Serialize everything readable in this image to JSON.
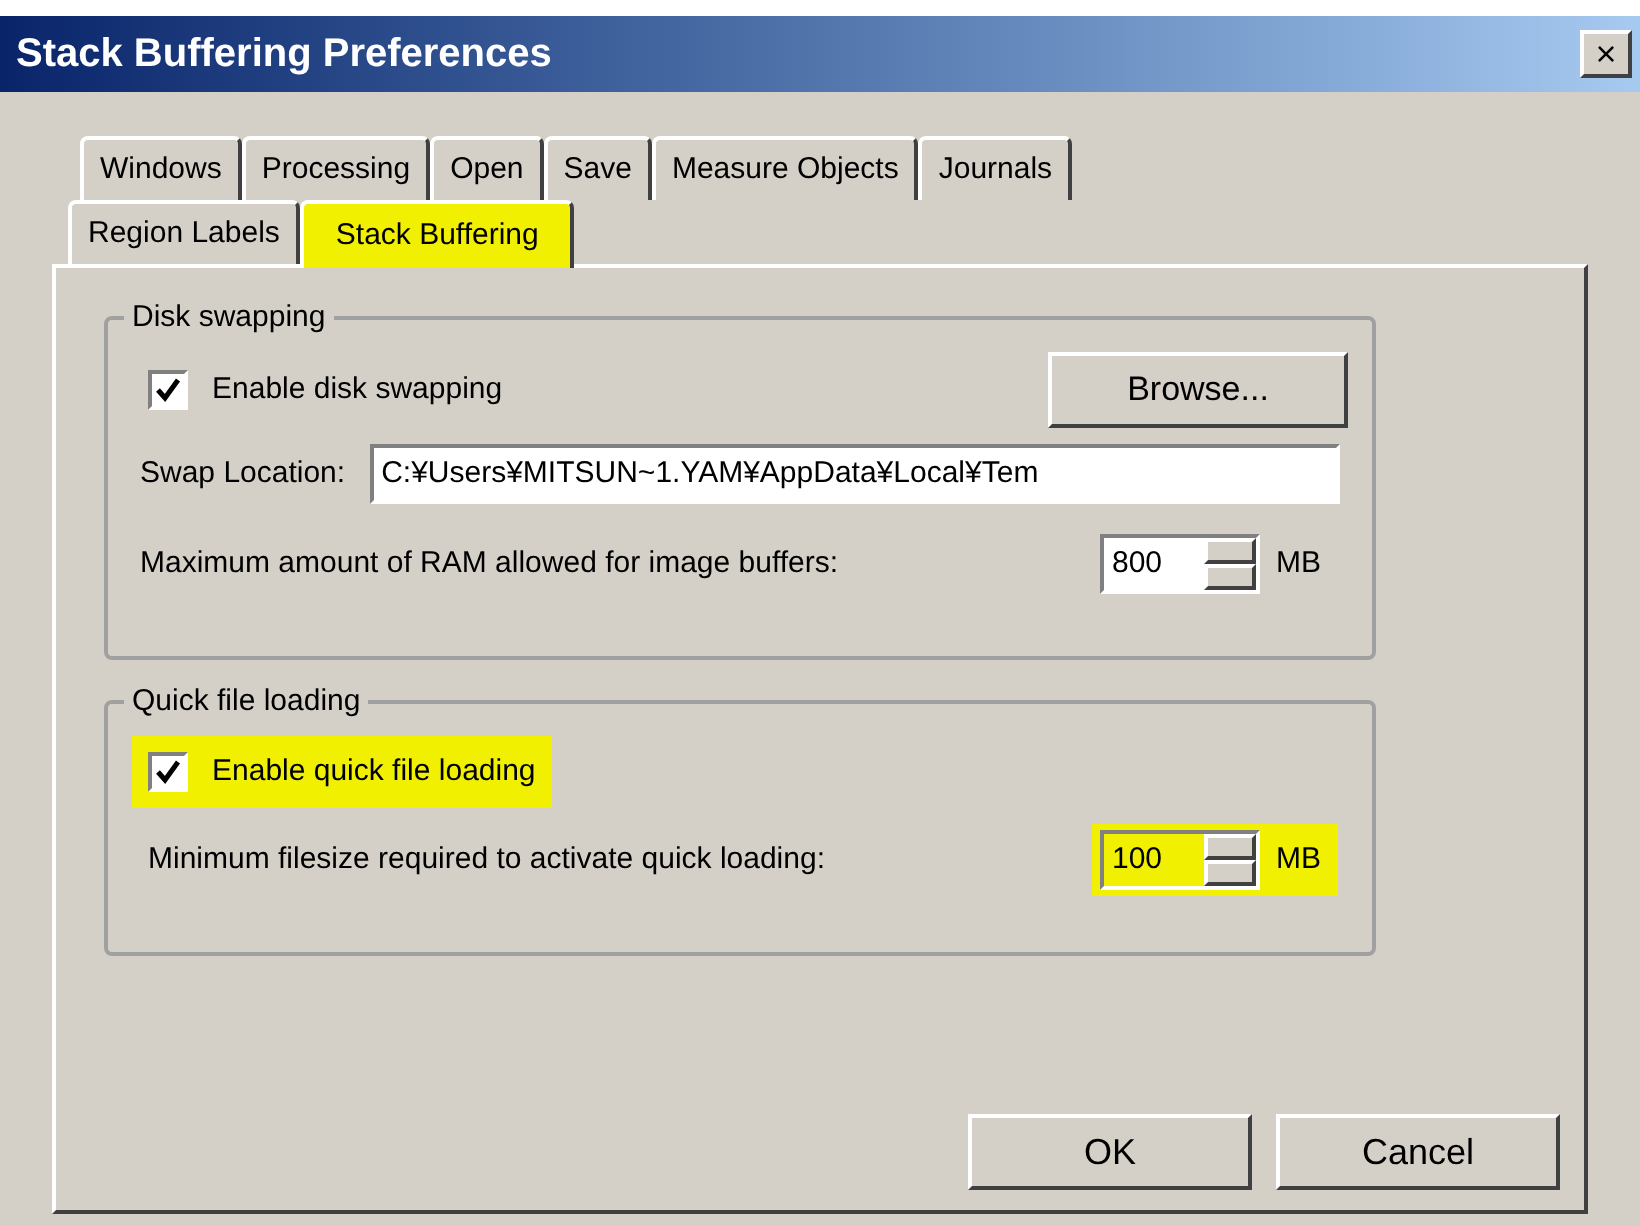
{
  "window": {
    "title": "Stack Buffering Preferences",
    "close": "×"
  },
  "tab_rows": [
    [
      {
        "label": "Windows",
        "selected": false,
        "highlighted": false
      },
      {
        "label": "Processing",
        "selected": false,
        "highlighted": false
      },
      {
        "label": "Open",
        "selected": false,
        "highlighted": false
      },
      {
        "label": "Save",
        "selected": false,
        "highlighted": false
      },
      {
        "label": "Measure Objects",
        "selected": false,
        "highlighted": false
      },
      {
        "label": "Journals",
        "selected": false,
        "highlighted": false
      }
    ],
    [
      {
        "label": "Region Labels",
        "selected": false,
        "highlighted": false
      },
      {
        "label": "Stack Buffering",
        "selected": true,
        "highlighted": true
      }
    ]
  ],
  "disk_swapping": {
    "title": "Disk swapping",
    "checkbox": {
      "label": "Enable disk swapping",
      "checked": true,
      "highlighted": false
    },
    "browse_button": "Browse...",
    "swap_location": {
      "label": "Swap Location:",
      "value": "C:¥Users¥MITSUN~1.YAM¥AppData¥Local¥Tem"
    },
    "max_ram": {
      "label": "Maximum amount of RAM allowed for image buffers:",
      "value": "800",
      "unit": "MB",
      "highlighted": false
    }
  },
  "quick_file_loading": {
    "title": "Quick file loading",
    "checkbox": {
      "label": "Enable quick file loading",
      "checked": true,
      "highlighted": true
    },
    "min_filesize": {
      "label": "Minimum filesize required to activate quick loading:",
      "value": "100",
      "unit": "MB",
      "highlighted": true
    }
  },
  "buttons": [
    "OK",
    "Cancel"
  ]
}
